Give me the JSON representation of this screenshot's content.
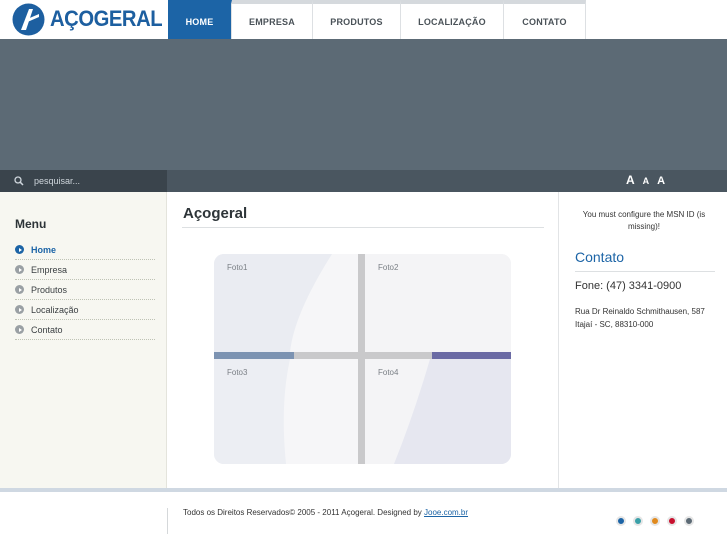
{
  "logo": {
    "text": "AÇOGERAL"
  },
  "nav": {
    "items": [
      {
        "label": "HOME",
        "active": true
      },
      {
        "label": "EMPRESA"
      },
      {
        "label": "PRODUTOS"
      },
      {
        "label": "LOCALIZAÇÃO"
      },
      {
        "label": "CONTATO"
      }
    ]
  },
  "search": {
    "placeholder": "pesquisar..."
  },
  "font_size_controls": [
    "A",
    "A",
    "A"
  ],
  "sidebar": {
    "title": "Menu",
    "items": [
      {
        "label": "Home",
        "active": true
      },
      {
        "label": "Empresa"
      },
      {
        "label": "Produtos"
      },
      {
        "label": "Localização"
      },
      {
        "label": "Contato"
      }
    ]
  },
  "main": {
    "title": "Açogeral",
    "gallery": [
      "Foto1",
      "Foto2",
      "Foto3",
      "Foto4"
    ]
  },
  "right": {
    "msn_notice": "You must configure the MSN ID (is missing)!",
    "contato_title": "Contato",
    "fone": "Fone: (47) 3341-0900",
    "address_line1": "Rua Dr Reinaldo Schmithausen, 587",
    "address_line2": "Itajaí - SC, 88310-000"
  },
  "footer": {
    "copyright": "Todos os Direitos Reservados© 2005 - 2011 Açogeral. Designed by ",
    "designer_link": "Jooe.com.br",
    "theme_colors": [
      "#1c64a6",
      "#3aa0a8",
      "#e08a1e",
      "#c8102e",
      "#5c6a75"
    ]
  },
  "colors": {
    "accent": "#1c64a6",
    "banner": "#5c6a75",
    "toolbar": "#4a5660"
  }
}
